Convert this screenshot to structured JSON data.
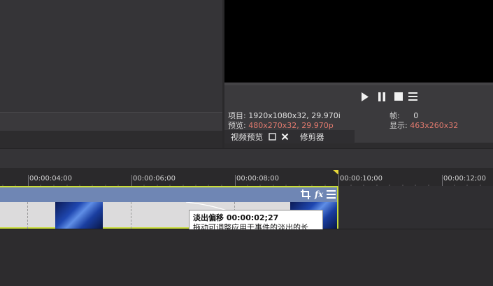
{
  "transport": {
    "play_icon": "play-icon",
    "pause_icon": "pause-icon",
    "stop_icon": "stop-icon",
    "menu_icon": "menu-icon"
  },
  "info": {
    "project_label": "项目:",
    "project_value": "1920x1080x32, 29.970i",
    "preview_label": "预览:",
    "preview_value": "480x270x32, 29.970p",
    "frame_label": "帧:",
    "frame_value": "0",
    "display_label": "显示:",
    "display_value": "463x260x32"
  },
  "tabs": {
    "video_preview": "视频预览",
    "trimmer": "修剪器"
  },
  "ruler": {
    "labels": [
      "00:00:04;00",
      "00:00:06;00",
      "00:00:08;00",
      "00:00:10;00",
      "00:00:12;00"
    ]
  },
  "tooltip": {
    "title": "淡出偏移 00:00:02;27",
    "body": "拖动可调整应用于事件的淡出的长度。"
  },
  "colors": {
    "accent_yellow": "#c9dc3a",
    "clip_header": "#6f86b4",
    "info_red": "#e27a6e"
  }
}
